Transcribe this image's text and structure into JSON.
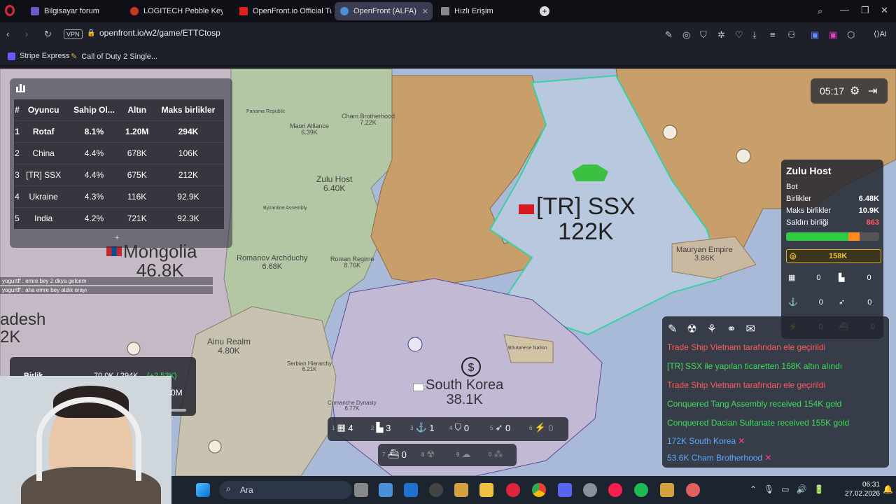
{
  "tabs": [
    {
      "title": "Bilgisayar forum",
      "color": "#6a5acd"
    },
    {
      "title": "LOGITECH Pebble Keys 2 K",
      "color": "#c0392b"
    },
    {
      "title": "OpenFront.io Official Tuto",
      "color": "#e02020"
    },
    {
      "title": "OpenFront (ALFA)",
      "color": "#4a90d9"
    },
    {
      "title": "Hızlı Erişim",
      "color": "#888888"
    }
  ],
  "address": {
    "vpn": "VPN",
    "url": "openfront.io/w2/game/ETTCtosp"
  },
  "ai_label": "AI",
  "bookmarks": [
    {
      "label": "Stripe Express"
    },
    {
      "label": "Call of Duty 2 Single..."
    }
  ],
  "leaderboard": {
    "headers": [
      "#",
      "Oyuncu",
      "Sahip Ol...",
      "Altın",
      "Maks birlikler"
    ],
    "rows": [
      {
        "rank": "1",
        "name": "Rotaf",
        "owned": "8.1%",
        "gold": "1.20M",
        "troops": "294K"
      },
      {
        "rank": "2",
        "name": "China",
        "owned": "4.4%",
        "gold": "678K",
        "troops": "106K"
      },
      {
        "rank": "3",
        "name": "[TR] SSX",
        "owned": "4.4%",
        "gold": "675K",
        "troops": "212K"
      },
      {
        "rank": "4",
        "name": "Ukraine",
        "owned": "4.3%",
        "gold": "116K",
        "troops": "92.9K"
      },
      {
        "rank": "5",
        "name": "India",
        "owned": "4.2%",
        "gold": "721K",
        "troops": "92.3K"
      }
    ],
    "expand": "+"
  },
  "timer": "05:17",
  "map_labels": [
    {
      "name": "Cham Brotherhood",
      "value": "7.22K"
    },
    {
      "name": "Maori Alliance",
      "value": "6.39K"
    },
    {
      "name": "Zulu Host",
      "value": "6.40K"
    },
    {
      "name": "Byzantine Assembly",
      "value": ""
    },
    {
      "name": "Romanov Archduchy",
      "value": "6.68K"
    },
    {
      "name": "Roman Regime",
      "value": "8.76K"
    },
    {
      "name": "Ainu Realm",
      "value": "4.80K"
    },
    {
      "name": "Serbian Hierarchy",
      "value": "6.21K"
    },
    {
      "name": "Comanche Dynasty",
      "value": "6.77K"
    },
    {
      "name": "Bhutanese Nation",
      "value": ""
    },
    {
      "name": "Mauryan Empire",
      "value": "3.86K"
    },
    {
      "name": "Panama Republic",
      "value": ""
    }
  ],
  "big_labels": {
    "ssx_name": "[TR] SSX",
    "ssx_value": "122K",
    "mongolia_name": "Mongolia",
    "mongolia_value": "46.8K",
    "korea_name": "South Korea",
    "korea_value": "38.1K",
    "desh_name": "adesh",
    "desh_value": "2K"
  },
  "chat": [
    "yogurtff : emre bey 2 dkya gelcem",
    "yogurtff : aha emre bey aldık orayı"
  ],
  "player_panel": {
    "name": "Zulu Host",
    "type": "Bot",
    "troops_label": "Birlikler",
    "troops": "6.48K",
    "max_label": "Maks birlikler",
    "max": "10.9K",
    "attack_label": "Saldırı birliği",
    "attack": "863",
    "troop_ratio": 0.79,
    "gold": "158K",
    "counts": [
      "0",
      "0",
      "0",
      "0",
      "0",
      "0"
    ]
  },
  "feed": [
    {
      "text": "Trade Ship Vietnam tarafından ele geçirildi",
      "color": "#ff5a5a"
    },
    {
      "text": "[TR] SSX ile yapılan ticaretten 168K altın alındı",
      "color": "#3ddc5a"
    },
    {
      "text": "Trade Ship Vietnam tarafından ele geçirildi",
      "color": "#ff5a5a"
    },
    {
      "text": "Conquered Tang Assembly received 154K gold",
      "color": "#3ddc5a"
    },
    {
      "text": "Conquered Dacian Sultanate received 155K gold",
      "color": "#3ddc5a"
    },
    {
      "text": "172K South Korea",
      "color": "#5aa8ff"
    },
    {
      "text": "53.6K Cham Brotherhood",
      "color": "#5aa8ff"
    }
  ],
  "build_bar": [
    {
      "key": "1",
      "count": "4"
    },
    {
      "key": "2",
      "count": "3"
    },
    {
      "key": "3",
      "count": "1"
    },
    {
      "key": "4",
      "count": "0"
    },
    {
      "key": "5",
      "count": "0"
    },
    {
      "key": "6",
      "count": "0"
    },
    {
      "key": "7",
      "count": "0"
    },
    {
      "key": "8",
      "count": ""
    },
    {
      "key": "9",
      "count": ""
    },
    {
      "key": "0",
      "count": ""
    }
  ],
  "bottom_panel": {
    "label": "Birlik",
    "value": "70.0K / 294K",
    "delta": "(+2.53K)",
    "extra": "0M"
  },
  "taskbar": {
    "search": "Ara",
    "time": "06:31",
    "date": "27.02.2026"
  }
}
